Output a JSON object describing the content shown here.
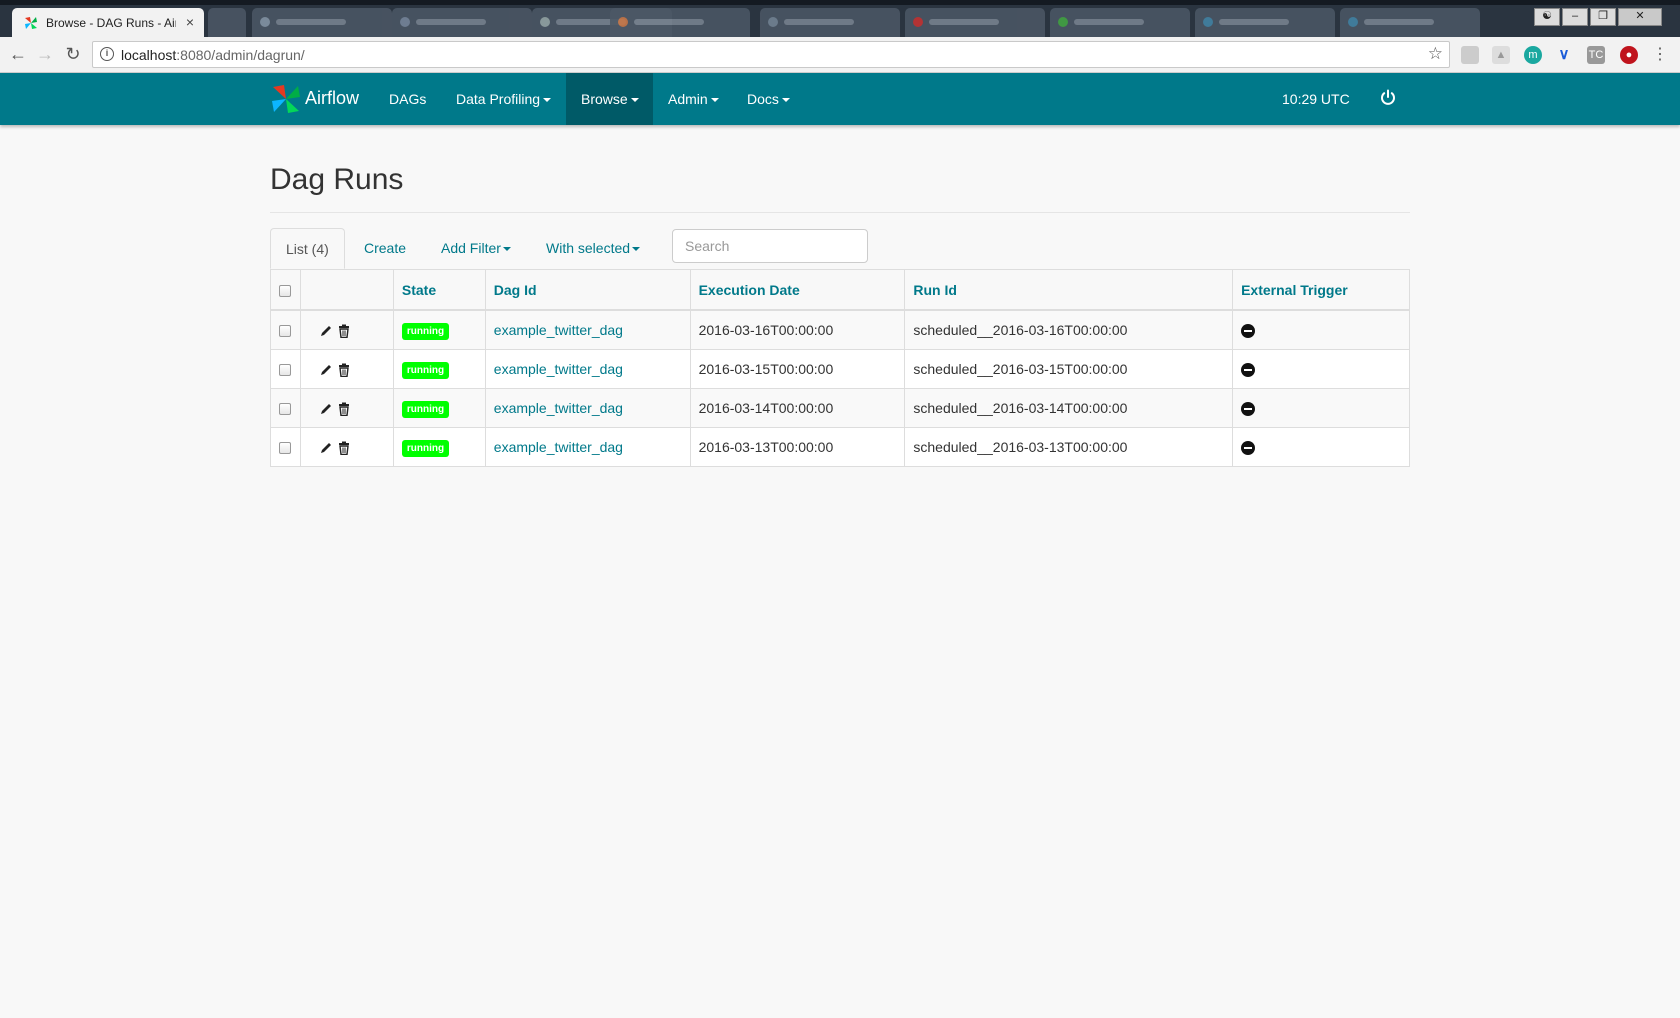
{
  "browser": {
    "active_tab_title": "Browse - DAG Runs - Air",
    "url_host": "localhost",
    "url_rest": ":8080/admin/dagrun/",
    "close_glyph": "×"
  },
  "navbar": {
    "brand": "Airflow",
    "items": [
      {
        "label": "DAGs",
        "dropdown": false
      },
      {
        "label": "Data Profiling",
        "dropdown": true
      },
      {
        "label": "Browse",
        "dropdown": true,
        "active": true
      },
      {
        "label": "Admin",
        "dropdown": true
      },
      {
        "label": "Docs",
        "dropdown": true
      }
    ],
    "time": "10:29 UTC",
    "color": "#00798a",
    "active_color": "#005a67"
  },
  "page": {
    "title": "Dag Runs"
  },
  "toolbar": {
    "list_label": "List (4)",
    "create_label": "Create",
    "add_filter_label": "Add Filter",
    "with_selected_label": "With selected",
    "search_placeholder": "Search"
  },
  "table": {
    "headers": {
      "state": "State",
      "dag_id": "Dag Id",
      "execution_date": "Execution Date",
      "run_id": "Run Id",
      "external_trigger": "External Trigger"
    },
    "rows": [
      {
        "state": "running",
        "dag_id": "example_twitter_dag",
        "execution_date": "2016-03-16T00:00:00",
        "run_id": "scheduled__2016-03-16T00:00:00",
        "external_trigger": false
      },
      {
        "state": "running",
        "dag_id": "example_twitter_dag",
        "execution_date": "2016-03-15T00:00:00",
        "run_id": "scheduled__2016-03-15T00:00:00",
        "external_trigger": false
      },
      {
        "state": "running",
        "dag_id": "example_twitter_dag",
        "execution_date": "2016-03-14T00:00:00",
        "run_id": "scheduled__2016-03-14T00:00:00",
        "external_trigger": false
      },
      {
        "state": "running",
        "dag_id": "example_twitter_dag",
        "execution_date": "2016-03-13T00:00:00",
        "run_id": "scheduled__2016-03-13T00:00:00",
        "external_trigger": false
      }
    ],
    "state_color": "#00ff00",
    "icons": {
      "edit": "pencil-icon",
      "delete": "trash-icon",
      "external_trigger_false": "minus-circle-icon"
    }
  }
}
